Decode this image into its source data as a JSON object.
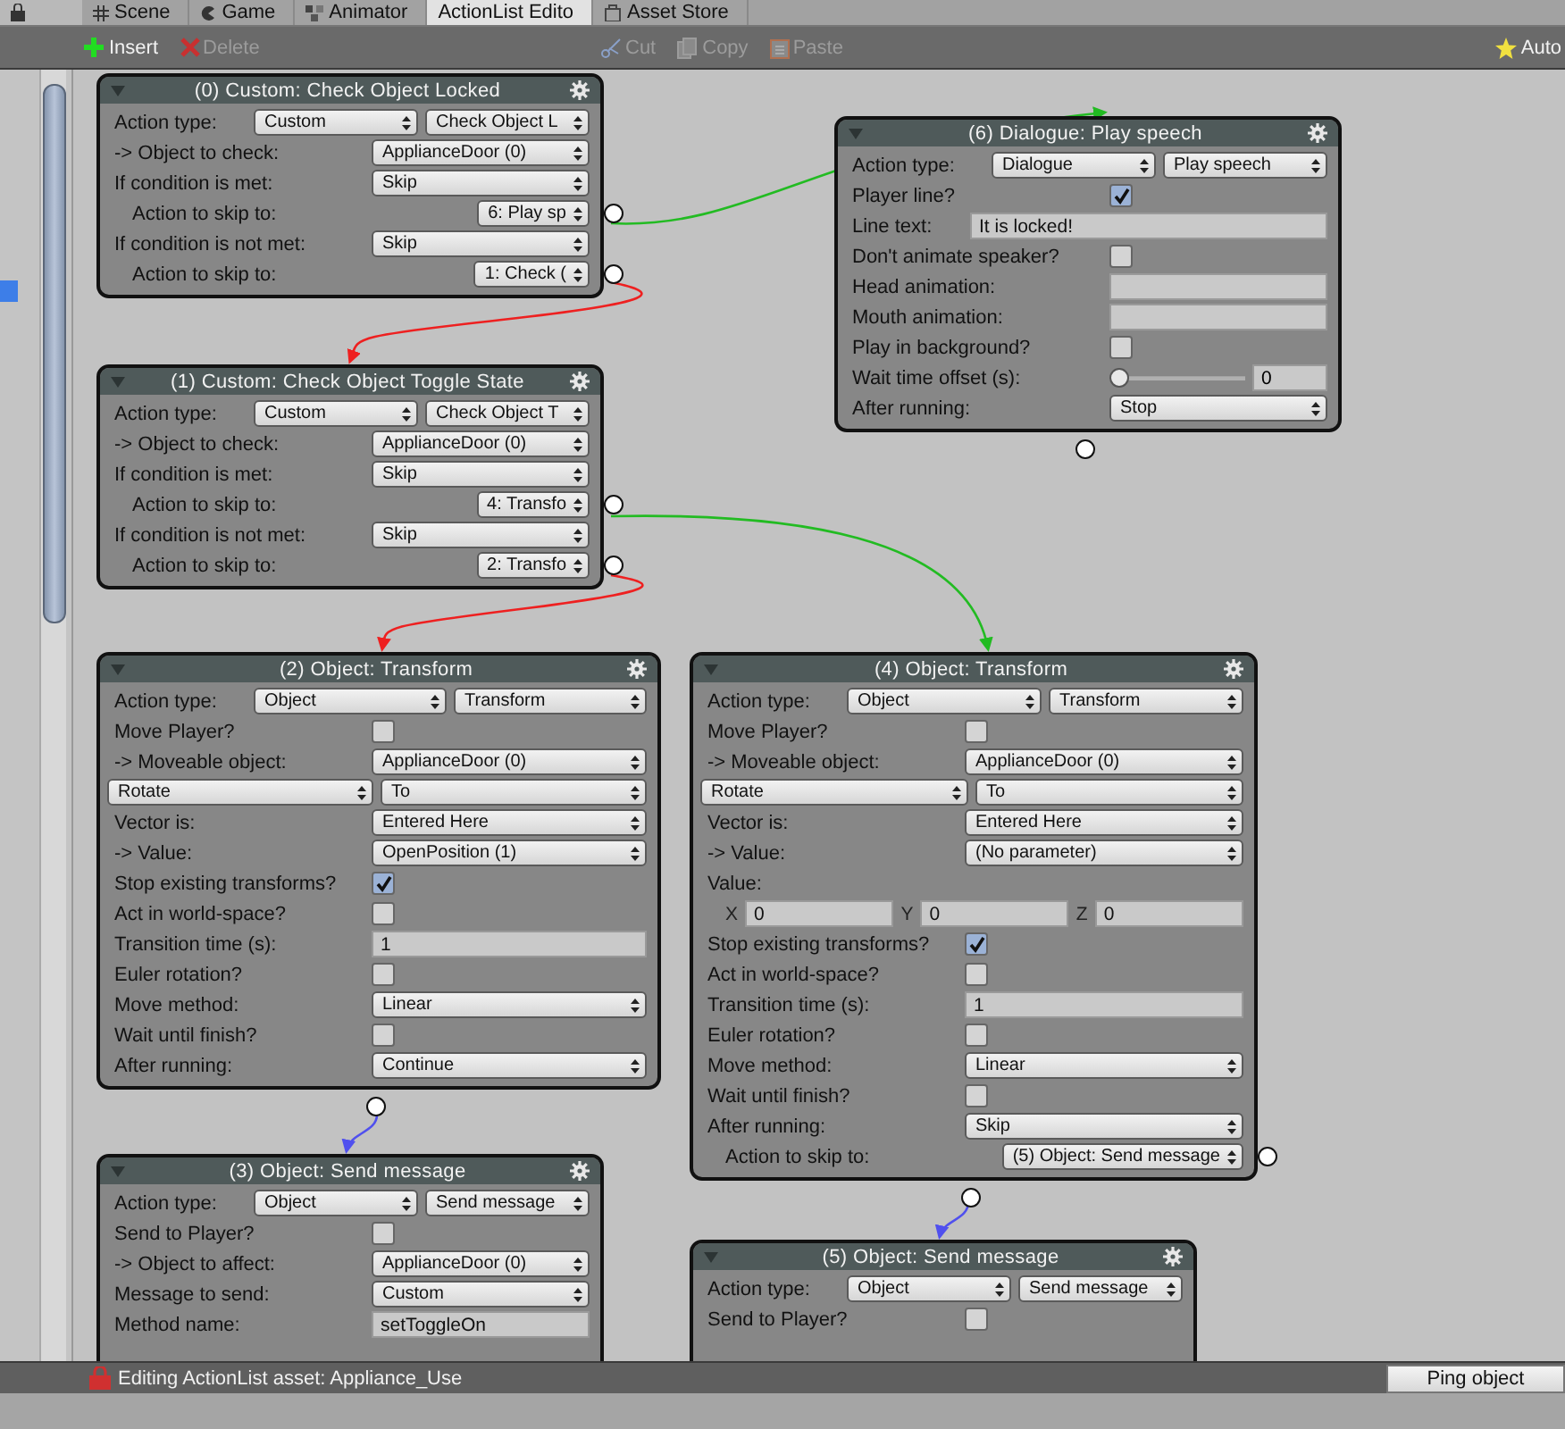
{
  "tabs": [
    {
      "label": "Scene",
      "selected": false
    },
    {
      "label": "Game",
      "selected": false
    },
    {
      "label": "Animator",
      "selected": false
    },
    {
      "label": "ActionList Edito",
      "selected": true
    },
    {
      "label": "Asset Store",
      "selected": false
    }
  ],
  "toolbar": [
    {
      "label": "Insert",
      "disabled": false
    },
    {
      "label": "Delete",
      "disabled": true
    },
    {
      "label": "Cut",
      "disabled": true
    },
    {
      "label": "Copy",
      "disabled": true
    },
    {
      "label": "Paste",
      "disabled": true
    },
    {
      "label": "Auto",
      "disabled": false
    }
  ],
  "nodes": [
    {
      "title": "(0) Custom: Check Object Locked",
      "rows": [
        {
          "kind": "type",
          "label": "Action type:",
          "values": [
            "Custom",
            "Check Object L"
          ]
        },
        {
          "kind": "select",
          "label": "-> Object to check:",
          "value": "ApplianceDoor (0)"
        },
        {
          "kind": "select",
          "label": "If condition is met:",
          "value": "Skip"
        },
        {
          "kind": "skip",
          "label": "Action to skip to:",
          "value": "6: Play sp"
        },
        {
          "kind": "select",
          "label": "If condition is not met:",
          "value": "Skip"
        },
        {
          "kind": "skip",
          "label": "Action to skip to:",
          "value": "1: Check ("
        }
      ]
    },
    {
      "title": "(6) Dialogue: Play speech",
      "rows": [
        {
          "kind": "type",
          "label": "Action type:",
          "values": [
            "Dialogue",
            "Play speech"
          ]
        },
        {
          "kind": "check",
          "label": "Player line?",
          "checked": true
        },
        {
          "kind": "wide_field",
          "label": "Line text:",
          "value": "It is locked!"
        },
        {
          "kind": "check",
          "label": "Don't animate speaker?",
          "checked": false
        },
        {
          "kind": "field",
          "label": "Head animation:"
        },
        {
          "kind": "field",
          "label": "Mouth animation:"
        },
        {
          "kind": "check",
          "label": "Play in background?",
          "checked": false
        },
        {
          "kind": "slider",
          "label": "Wait time offset (s):",
          "level": 0,
          "value": "0"
        },
        {
          "kind": "select",
          "label": "After running:",
          "value": "Stop"
        }
      ]
    },
    {
      "title": "(1) Custom: Check Object Toggle State",
      "rows": [
        {
          "kind": "type",
          "label": "Action type:",
          "values": [
            "Custom",
            "Check Object T"
          ]
        },
        {
          "kind": "select",
          "label": "-> Object to check:",
          "value": "ApplianceDoor (0)"
        },
        {
          "kind": "select",
          "label": "If condition is met:",
          "value": "Skip"
        },
        {
          "kind": "skip",
          "label": "Action to skip to:",
          "value": "4: Transfo"
        },
        {
          "kind": "select",
          "label": "If condition is not met:",
          "value": "Skip"
        },
        {
          "kind": "skip",
          "label": "Action to skip to:",
          "value": "2: Transfo"
        }
      ]
    },
    {
      "title": "(2) Object: Transform",
      "rows": [
        {
          "kind": "type",
          "label": "Action type:",
          "values": [
            "Object",
            "Transform"
          ]
        },
        {
          "kind": "check",
          "label": "Move Player?",
          "checked": false
        },
        {
          "kind": "select",
          "label": "-> Moveable object:",
          "value": "ApplianceDoor (0)"
        },
        {
          "kind": "pair",
          "values": [
            "Rotate",
            "To"
          ]
        },
        {
          "kind": "select",
          "label": "Vector is:",
          "value": "Entered Here"
        },
        {
          "kind": "select",
          "label": "-> Value:",
          "value": "OpenPosition (1)"
        },
        {
          "kind": "check",
          "label": "Stop existing transforms?",
          "checked": true
        },
        {
          "kind": "check",
          "label": "Act in world-space?",
          "checked": false
        },
        {
          "kind": "field",
          "label": "Transition time (s):",
          "value": "1"
        },
        {
          "kind": "check",
          "label": "Euler rotation?",
          "checked": false
        },
        {
          "kind": "select",
          "label": "Move method:",
          "value": "Linear"
        },
        {
          "kind": "check",
          "label": "Wait until finish?",
          "checked": false
        },
        {
          "kind": "select",
          "label": "After running:",
          "value": "Continue"
        }
      ]
    },
    {
      "title": "(4) Object: Transform",
      "rows": [
        {
          "kind": "type",
          "label": "Action type:",
          "values": [
            "Object",
            "Transform"
          ]
        },
        {
          "kind": "check",
          "label": "Move Player?",
          "checked": false
        },
        {
          "kind": "select",
          "label": "-> Moveable object:",
          "value": "ApplianceDoor (0)"
        },
        {
          "kind": "pair",
          "values": [
            "Rotate",
            "To"
          ]
        },
        {
          "kind": "select",
          "label": "Vector is:",
          "value": "Entered Here"
        },
        {
          "kind": "select",
          "label": "-> Value:",
          "value": "(No parameter)"
        },
        {
          "kind": "vector",
          "label": "Value:",
          "axes": [
            {
              "axis": "X",
              "value": "0"
            },
            {
              "axis": "Y",
              "value": "0"
            },
            {
              "axis": "Z",
              "value": "0"
            }
          ]
        },
        {
          "kind": "check",
          "label": "Stop existing transforms?",
          "checked": true
        },
        {
          "kind": "check",
          "label": "Act in world-space?",
          "checked": false
        },
        {
          "kind": "field",
          "label": "Transition time (s):",
          "value": "1"
        },
        {
          "kind": "check",
          "label": "Euler rotation?",
          "checked": false
        },
        {
          "kind": "select",
          "label": "Move method:",
          "value": "Linear"
        },
        {
          "kind": "check",
          "label": "Wait until finish?",
          "checked": false
        },
        {
          "kind": "select",
          "label": "After running:",
          "value": "Skip"
        },
        {
          "kind": "skip",
          "label": "Action to skip to:",
          "value": "(5) Object: Send message"
        }
      ]
    },
    {
      "title": "(3) Object: Send message",
      "rows": [
        {
          "kind": "type",
          "label": "Action type:",
          "values": [
            "Object",
            "Send message"
          ]
        },
        {
          "kind": "check",
          "label": "Send to Player?",
          "checked": false
        },
        {
          "kind": "select",
          "label": "-> Object to affect:",
          "value": "ApplianceDoor (0)"
        },
        {
          "kind": "select",
          "label": "Message to send:",
          "value": "Custom"
        },
        {
          "kind": "field",
          "label": "Method name:",
          "value": "setToggleOn"
        }
      ]
    },
    {
      "title": "(5) Object: Send message",
      "rows": [
        {
          "kind": "type",
          "label": "Action type:",
          "values": [
            "Object",
            "Send message"
          ]
        },
        {
          "kind": "check",
          "label": "Send to Player?",
          "checked": false
        }
      ]
    }
  ],
  "status_bar": {
    "text": "Editing ActionList asset: Appliance_Use",
    "button": "Ping object"
  }
}
